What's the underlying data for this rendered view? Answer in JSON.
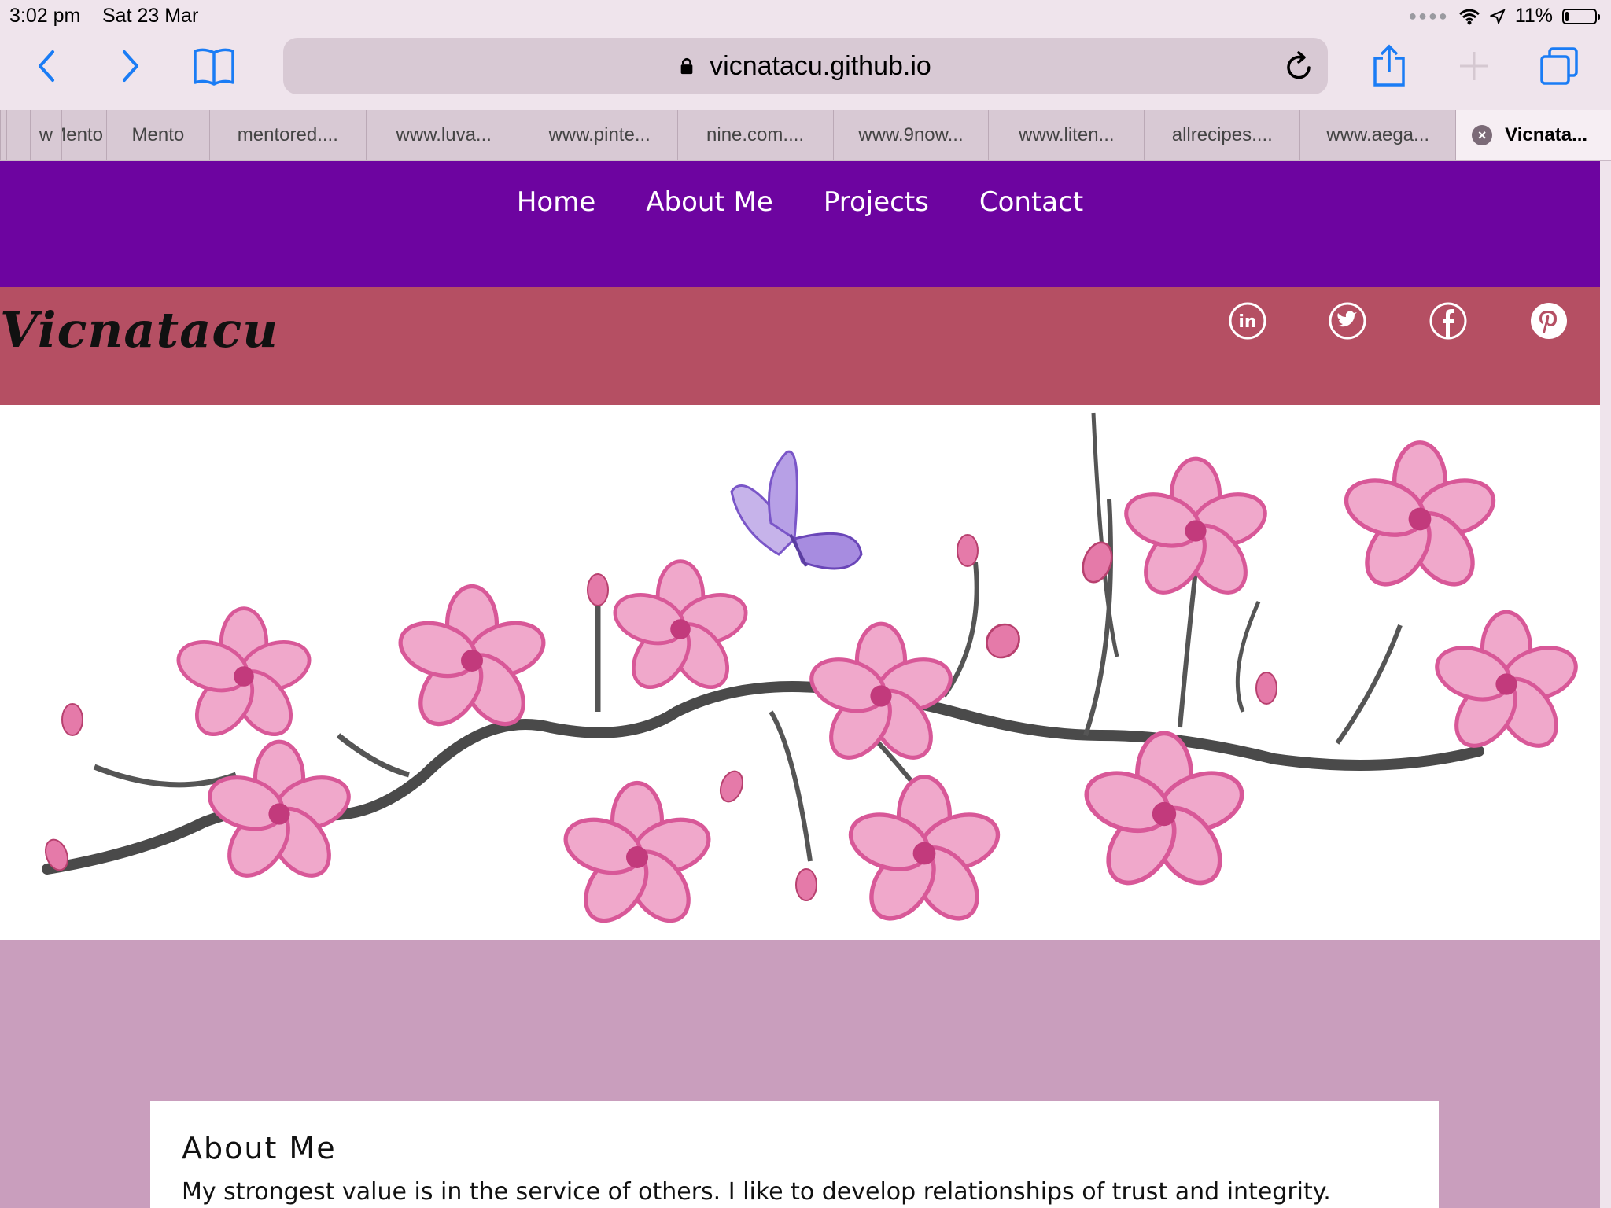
{
  "status_bar": {
    "time": "3:02 pm",
    "date": "Sat 23 Mar",
    "battery_text": "11%",
    "battery_level": 0.11
  },
  "browser": {
    "url": "vicnatacu.github.io",
    "tabs": [
      {
        "label": ""
      },
      {
        "label": ""
      },
      {
        "label": "w"
      },
      {
        "label": "Mento"
      },
      {
        "label": "mentored...."
      },
      {
        "label": "www.luva..."
      },
      {
        "label": "www.pinte..."
      },
      {
        "label": "nine.com...."
      },
      {
        "label": "www.9now..."
      },
      {
        "label": "www.liten..."
      },
      {
        "label": "allrecipes...."
      },
      {
        "label": "www.aega..."
      },
      {
        "label": "Vicnata...",
        "active": true
      }
    ]
  },
  "site": {
    "nav": [
      "Home",
      "About Me",
      "Projects",
      "Contact"
    ],
    "brand": "Vicnatacu",
    "social": [
      "linkedin-icon",
      "twitter-icon",
      "facebook-icon",
      "pinterest-icon"
    ],
    "about": {
      "title": "About Me",
      "text": "My strongest value is in the service of others. I like to develop relationships of trust and integrity."
    }
  },
  "colors": {
    "nav_bg": "#6d04a0",
    "header_bg": "#b54f63",
    "page_bg": "#c99ebd",
    "ios_blue": "#1a7cf5"
  }
}
